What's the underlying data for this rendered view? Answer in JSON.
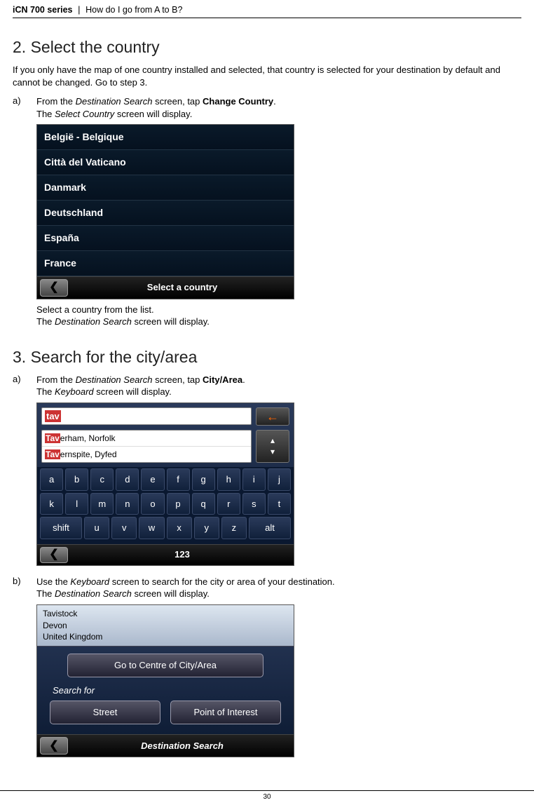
{
  "header": {
    "product": "iCN 700 series",
    "separator": "|",
    "topic": "How do I go from A to B?"
  },
  "section2": {
    "title": "2. Select the country",
    "intro": "If you only have the map of one country installed and selected, that country is selected for your destination by default and cannot be changed. Go to step 3.",
    "step_a_letter": "a)",
    "step_a_line1_pre": "From the ",
    "step_a_line1_em": "Destination Search",
    "step_a_line1_mid": " screen, tap ",
    "step_a_line1_b": "Change Country",
    "step_a_line1_post": ".",
    "step_a_line2_pre": "The ",
    "step_a_line2_em": "Select Country",
    "step_a_line2_post": " screen will display.",
    "countries": [
      "België - Belgique",
      "Città del Vaticano",
      "Danmark",
      "Deutschland",
      "España",
      "France"
    ],
    "bottom_label": "Select a country",
    "after1": "Select a country from the list.",
    "after2_pre": "The ",
    "after2_em": "Destination Search",
    "after2_post": " screen will display."
  },
  "section3": {
    "title": "3. Search for the city/area",
    "step_a_letter": "a)",
    "step_a_line1_pre": "From the ",
    "step_a_line1_em": "Destination Search",
    "step_a_line1_mid": " screen, tap ",
    "step_a_line1_b": "City/Area",
    "step_a_line1_post": ".",
    "step_a_line2_pre": "The ",
    "step_a_line2_em": "Keyboard",
    "step_a_line2_post": " screen will display.",
    "kb_typed": "tav",
    "kb_suggest1_hl": "Tav",
    "kb_suggest1_rest": "erham, Norfolk",
    "kb_suggest2_hl": "Tav",
    "kb_suggest2_rest": "ernspite, Dyfed",
    "keys_row1": [
      "a",
      "b",
      "c",
      "d",
      "e",
      "f",
      "g",
      "h",
      "i",
      "j"
    ],
    "keys_row2": [
      "k",
      "l",
      "m",
      "n",
      "o",
      "p",
      "q",
      "r",
      "s",
      "t"
    ],
    "keys_row3": [
      "shift",
      "u",
      "v",
      "w",
      "x",
      "y",
      "z",
      "alt"
    ],
    "kb_num": "123",
    "step_b_letter": "b)",
    "step_b_line1_pre": "Use the ",
    "step_b_line1_em": "Keyboard",
    "step_b_line1_post": " screen to search for the city or area of your destination.",
    "step_b_line2_pre": "The ",
    "step_b_line2_em": "Destination Search",
    "step_b_line2_post": " screen will display.",
    "dest_lines": [
      "Tavistock",
      "Devon",
      "United Kingdom"
    ],
    "btn_goto": "Go to Centre of City/Area",
    "search_for": "Search for",
    "btn_street": "Street",
    "btn_poi": "Point of Interest",
    "dest_bottom": "Destination Search"
  },
  "page_number": "30"
}
